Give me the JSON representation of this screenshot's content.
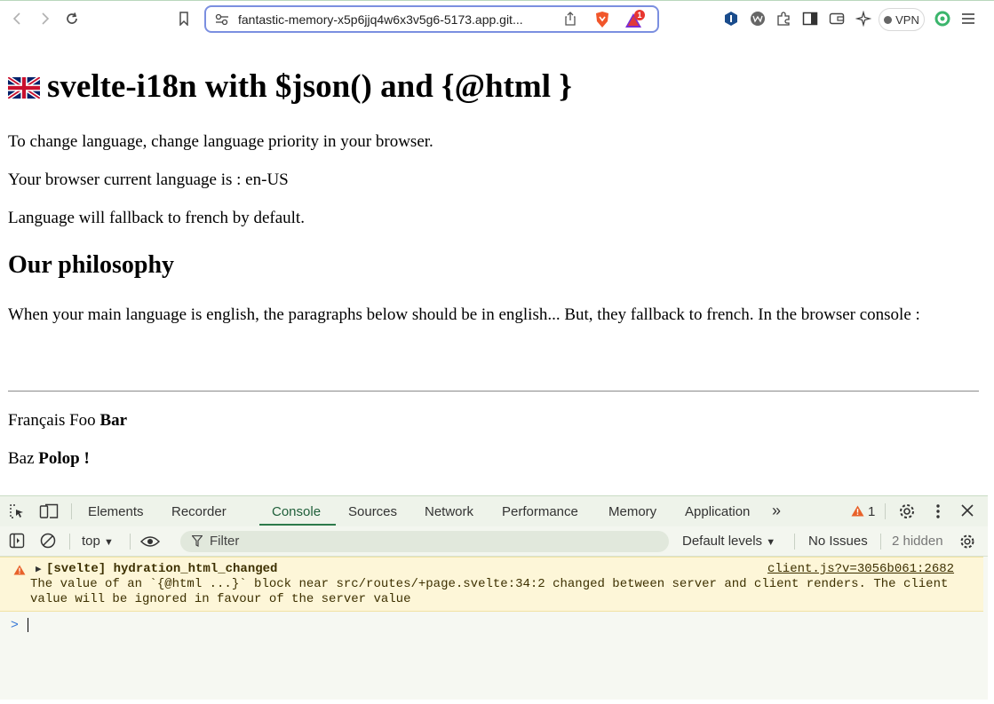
{
  "browser": {
    "url": "fantastic-memory-x5p6jjq4w6x3v5g6-5173.app.git...",
    "vpn_label": "VPN",
    "shield_badge": "1"
  },
  "page": {
    "title": "svelte-i18n with $json() and {@html }",
    "lines": [
      "To change language, change language priority in your browser.",
      "Your browser current language is : en-US",
      "Language will fallback to french by default."
    ],
    "philosophy_heading": "Our philosophy",
    "philosophy_text": "When your main language is english, the paragraphs below should be in english... But, they fallback to french. In the browser console :",
    "para1_normal": "Français Foo ",
    "para1_bold": "Bar",
    "para2_normal": "Baz ",
    "para2_bold": "Polop !"
  },
  "devtools": {
    "tabs": [
      "Elements",
      "Recorder",
      "Console",
      "Sources",
      "Network",
      "Performance",
      "Memory",
      "Application"
    ],
    "more_tabs": "»",
    "warning_count": "1",
    "context": "top",
    "filter_placeholder": "Filter",
    "levels": "Default levels",
    "issues": "No Issues",
    "hidden": "2 hidden",
    "message": {
      "title": "[svelte] hydration_html_changed",
      "source": "client.js?v=3056b061:2682",
      "body_line1": "The value of an `{@html ...}` block near src/routes/+page.svelte:34:2 changed between server and client renders. The client",
      "body_line2": "value will be ignored in favour of the server value"
    },
    "prompt_symbol": ">"
  }
}
